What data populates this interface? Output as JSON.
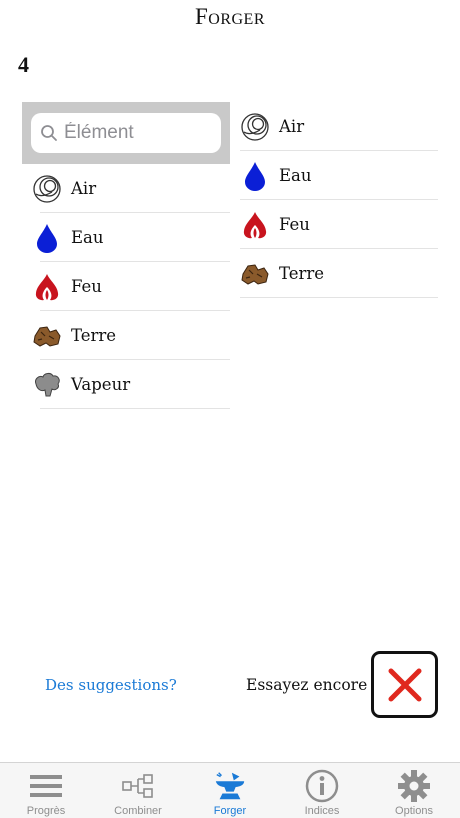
{
  "header": {
    "title": "Forger"
  },
  "count": "4",
  "search": {
    "placeholder": "Élément"
  },
  "left_list": [
    {
      "label": "Air",
      "icon": "air-icon"
    },
    {
      "label": "Eau",
      "icon": "water-drop-icon"
    },
    {
      "label": "Feu",
      "icon": "fire-icon"
    },
    {
      "label": "Terre",
      "icon": "earth-icon"
    },
    {
      "label": "Vapeur",
      "icon": "vapor-icon"
    }
  ],
  "right_list": [
    {
      "label": "Air",
      "icon": "air-icon"
    },
    {
      "label": "Eau",
      "icon": "water-drop-icon"
    },
    {
      "label": "Feu",
      "icon": "fire-icon"
    },
    {
      "label": "Terre",
      "icon": "earth-icon"
    }
  ],
  "footer": {
    "suggestions_link": "Des suggestions?",
    "retry_text": "Essayez encore"
  },
  "tabs": [
    {
      "label": "Progrès",
      "icon": "menu-lines-icon",
      "active": false
    },
    {
      "label": "Combiner",
      "icon": "combine-icon",
      "active": false
    },
    {
      "label": "Forger",
      "icon": "anvil-icon",
      "active": true
    },
    {
      "label": "Indices",
      "icon": "info-icon",
      "active": false
    },
    {
      "label": "Options",
      "icon": "gear-icon",
      "active": false
    }
  ],
  "colors": {
    "accent": "#1a7ad6",
    "water": "#0b1fd6",
    "fire": "#c8141e",
    "earth": "#7a4a1e",
    "close_red": "#e0281e",
    "search_bg": "#c9c9c9"
  }
}
